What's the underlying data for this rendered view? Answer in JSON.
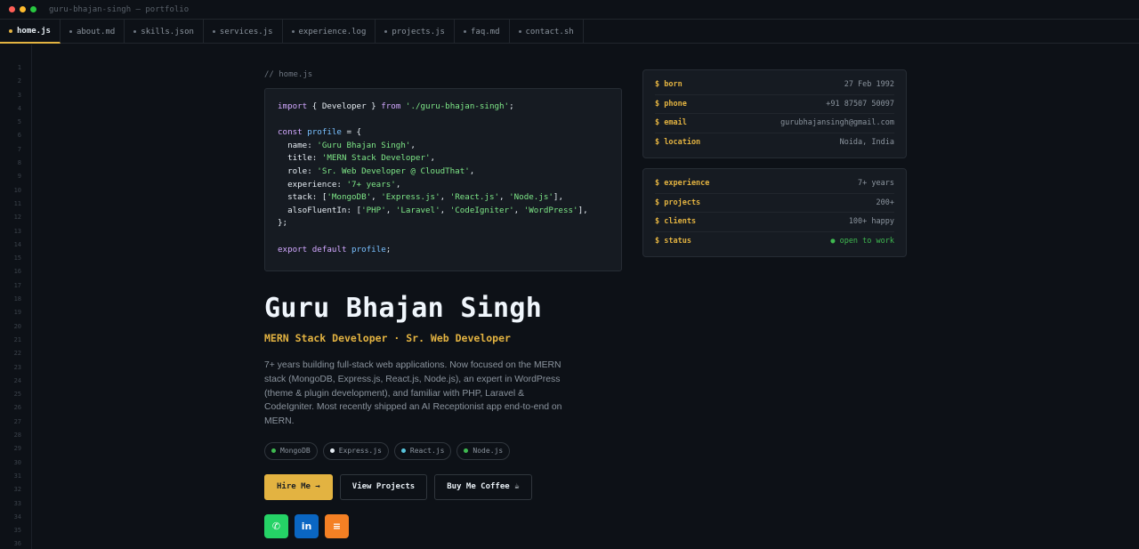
{
  "window": {
    "title": "guru-bhajan-singh — portfolio"
  },
  "tabs": [
    {
      "label": "home.js",
      "active": true
    },
    {
      "label": "about.md",
      "active": false
    },
    {
      "label": "skills.json",
      "active": false
    },
    {
      "label": "services.js",
      "active": false
    },
    {
      "label": "experience.log",
      "active": false
    },
    {
      "label": "projects.js",
      "active": false
    },
    {
      "label": "faq.md",
      "active": false
    },
    {
      "label": "contact.sh",
      "active": false
    }
  ],
  "gutter": {
    "first_line": 1,
    "last_line": 36
  },
  "main": {
    "breadcrumb": "// home.js",
    "code": {
      "import_line": {
        "kw_import": "import",
        "brace_open": " { ",
        "ident": "Developer",
        "brace_close": " } ",
        "kw_from": "from",
        "space": " ",
        "path": "'./guru-bhajan-singh'",
        "semi": ";"
      },
      "const_line": {
        "kw_const": "const",
        "space": " ",
        "var": "profile",
        "rest": " = {"
      },
      "props": [
        {
          "key": "name",
          "value": "'Guru Bhajan Singh'"
        },
        {
          "key": "title",
          "value": "'MERN Stack Developer'"
        },
        {
          "key": "role",
          "value": "'Sr. Web Developer @ CloudThat'"
        },
        {
          "key": "experience",
          "value": "'7+ years'"
        }
      ],
      "stack_key": "stack",
      "stack": [
        "'MongoDB'",
        "'Express.js'",
        "'React.js'",
        "'Node.js'"
      ],
      "fluent_key": "alsoFluentIn",
      "fluent": [
        "'PHP'",
        "'Laravel'",
        "'CodeIgniter'",
        "'WordPress'"
      ],
      "close": "};",
      "export_line": {
        "kw_export": "export",
        "kw_default": "default",
        "var": "profile",
        "semi": ";"
      }
    },
    "name": "Guru Bhajan Singh",
    "subtitle": "MERN Stack Developer · Sr. Web Developer",
    "bio": "7+ years building full-stack web applications. Now focused on the MERN stack (MongoDB, Express.js, React.js, Node.js), an expert in WordPress (theme & plugin development), and familiar with PHP, Laravel & CodeIgniter. Most recently shipped an AI Receptionist app end-to-end on MERN.",
    "chips": [
      {
        "label": "MongoDB",
        "color": "#3fb950"
      },
      {
        "label": "Express.js",
        "color": "#e6edf3"
      },
      {
        "label": "React.js",
        "color": "#58c4dc"
      },
      {
        "label": "Node.js",
        "color": "#3fb950"
      }
    ],
    "buttons": {
      "hire": "Hire Me →",
      "projects": "View Projects",
      "coffee": "Buy Me Coffee ☕"
    },
    "socials": [
      {
        "icon": "whatsapp-icon",
        "color": "#25d366",
        "glyph": "✆"
      },
      {
        "icon": "linkedin-icon",
        "color": "#0a66c2",
        "glyph": "in"
      },
      {
        "icon": "stackoverflow-icon",
        "color": "#f48024",
        "glyph": "≡"
      }
    ]
  },
  "info_card": [
    {
      "key": "$ born",
      "value": "27 Feb 1992"
    },
    {
      "key": "$ phone",
      "value": "+91 87507 50097"
    },
    {
      "key": "$ email",
      "value": "gurubhajansingh@gmail.com"
    },
    {
      "key": "$ location",
      "value": "Noida, India"
    }
  ],
  "stats_card": [
    {
      "key": "$ experience",
      "value": "7+ years"
    },
    {
      "key": "$ projects",
      "value": "200+"
    },
    {
      "key": "$ clients",
      "value": "100+ happy"
    },
    {
      "key": "$ status",
      "value": "● open to work"
    }
  ],
  "colors": {
    "accent": "#e3b341",
    "background": "#0d1117",
    "panel": "#161b22",
    "success": "#3fb950"
  }
}
